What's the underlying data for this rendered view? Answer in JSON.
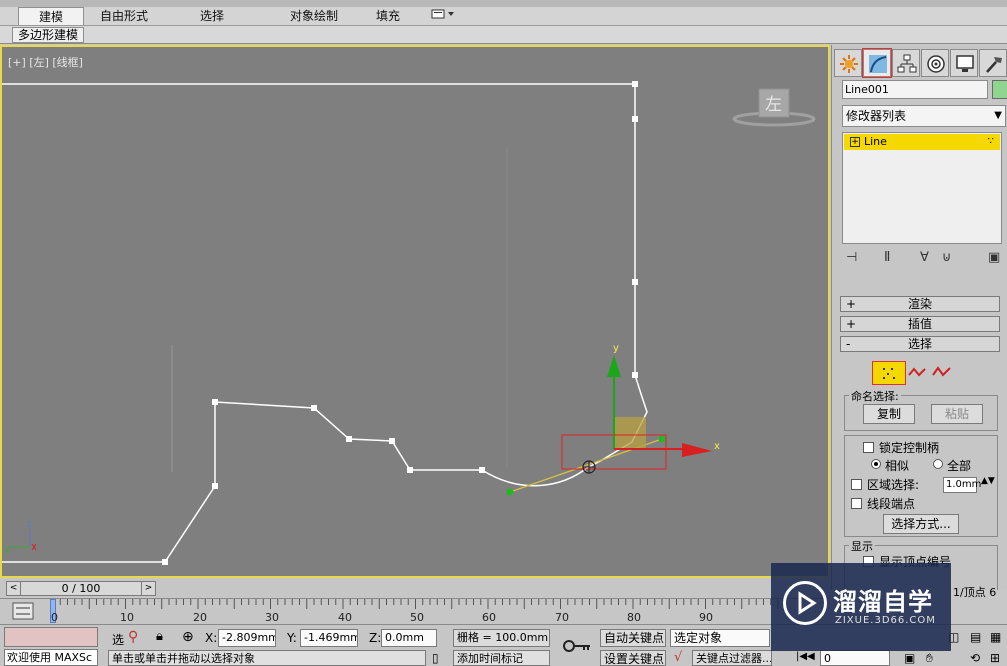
{
  "ribbon": {
    "tabs": [
      "建模",
      "自由形式",
      "选择",
      "对象绘制",
      "填充"
    ],
    "active_tab": "建模",
    "subtab": "多边形建模"
  },
  "viewport": {
    "label": "[+] [左] [线框]",
    "viewcube_label": "左",
    "axis_labels": {
      "y": "y",
      "x": "x"
    },
    "world_axis": {
      "z": "z",
      "y": "y"
    },
    "border_color": "#e8d84a"
  },
  "command_panel": {
    "object_name": "Line001",
    "object_color": "#8fd58f",
    "modifier_list": "修改器列表",
    "stack_item": "Line",
    "rollouts": {
      "render": "渲染",
      "interpolation": "插值",
      "selection": "选择"
    },
    "named_selection_title": "命名选择:",
    "copy_btn": "复制",
    "paste_btn": "粘贴",
    "lock_handles": "锁定控制柄",
    "alike": "相似",
    "all": "全部",
    "area_selection": "区域选择:",
    "area_value": "1.0mm",
    "segment_end": "线段端点",
    "select_by": "选择方式...",
    "display_title": "显示",
    "show_vertex_numbers": "显示顶点编号",
    "vertex_count": "1/顶点 6"
  },
  "timeline": {
    "frame_display": "0 / 100",
    "prev": "<",
    "next": ">",
    "ticks": [
      "0",
      "10",
      "20",
      "30",
      "40",
      "50",
      "60",
      "70",
      "80",
      "90"
    ]
  },
  "status": {
    "welcome": "欢迎使用 MAXSc",
    "select_label": "选",
    "x_label": "X:",
    "x_value": "-2.809mm",
    "y_label": "Y:",
    "y_value": "-1.469mm",
    "z_label": "Z:",
    "z_value": "0.0mm",
    "grid": "栅格 = 100.0mm",
    "prompt": "单击或单击并拖动以选择对象",
    "auto_key": "自动关键点",
    "set_key": "设置关键点",
    "selected_object": "选定对象",
    "add_time_tag": "添加时间标记",
    "key_filters": "关键点过滤器...",
    "frame_value": "0"
  },
  "watermark": {
    "title": "溜溜自学",
    "url": "ZIXUE.3D66.COM"
  }
}
